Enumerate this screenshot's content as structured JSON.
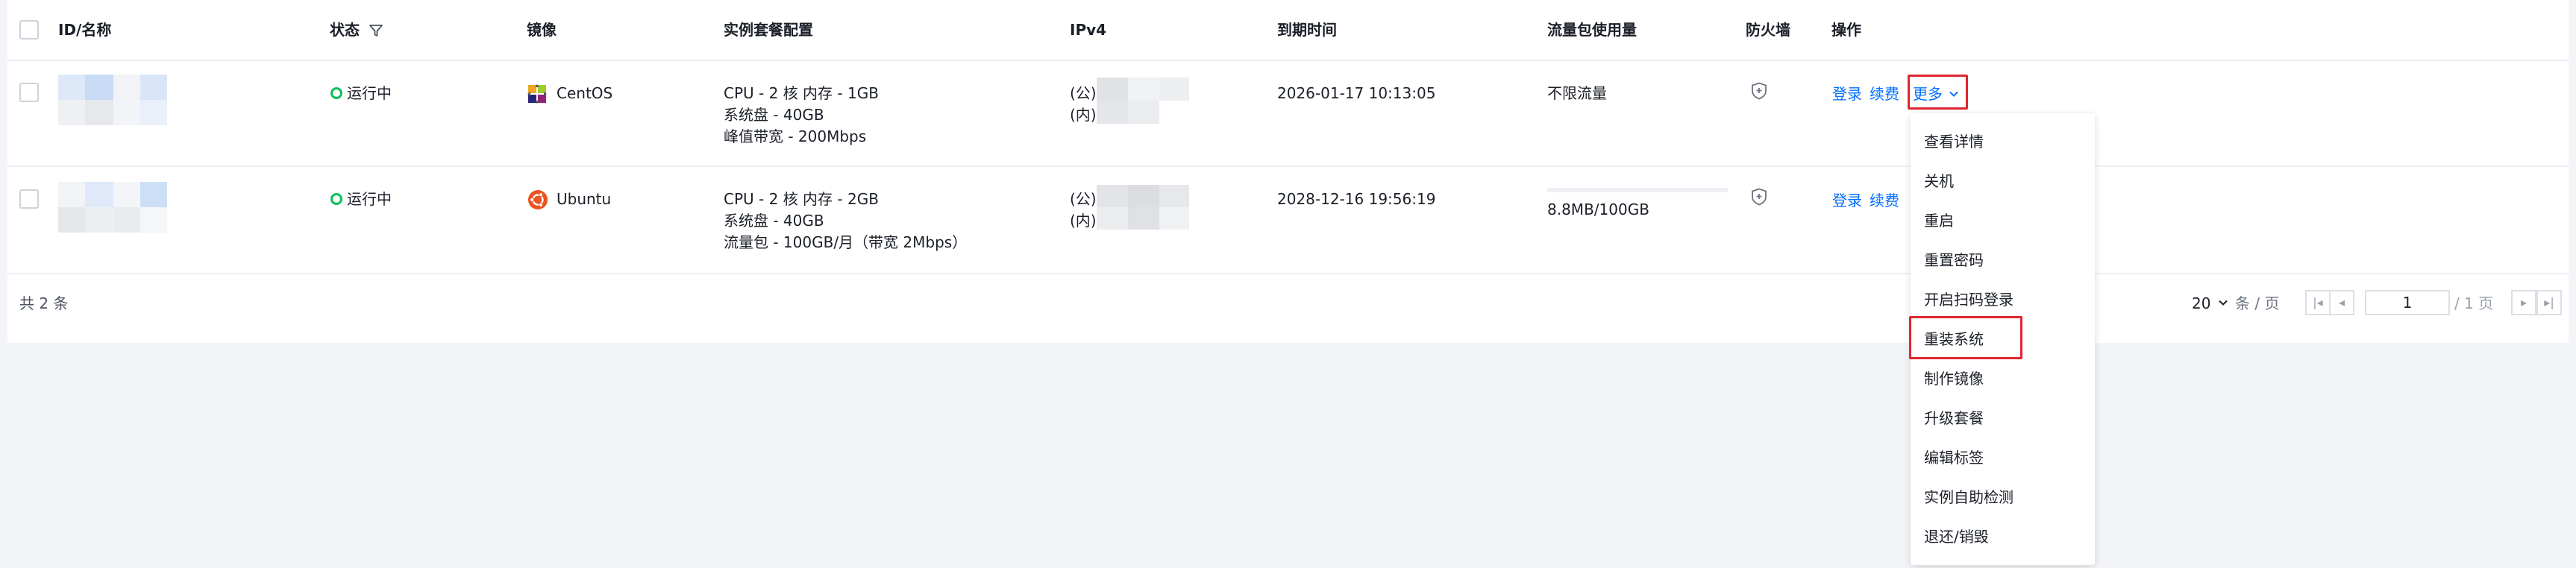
{
  "table": {
    "headers": {
      "id_name": "ID/名称",
      "status": "状态",
      "image": "镜像",
      "config": "实例套餐配置",
      "ipv4": "IPv4",
      "expire": "到期时间",
      "traffic": "流量包使用量",
      "firewall": "防火墙",
      "actions": "操作"
    },
    "rows": [
      {
        "status": "运行中",
        "image": "CentOS",
        "config": [
          "CPU - 2 核 内存 - 1GB",
          "系统盘 - 40GB",
          "峰值带宽 - 200Mbps"
        ],
        "ip_public_label": "(公)",
        "ip_private_label": "(内)",
        "expire": "2026-01-17 10:13:05",
        "traffic": "不限流量",
        "action_login": "登录",
        "action_renew": "续费",
        "action_more": "更多"
      },
      {
        "status": "运行中",
        "image": "Ubuntu",
        "config": [
          "CPU - 2 核 内存 - 2GB",
          "系统盘 - 40GB",
          "流量包 - 100GB/月（带宽 2Mbps）"
        ],
        "ip_public_label": "(公)",
        "ip_private_label": "(内)",
        "expire": "2028-12-16 19:56:19",
        "traffic": "8.8MB/100GB",
        "traffic_fraction": 0.0001,
        "action_login": "登录",
        "action_renew": "续费"
      }
    ]
  },
  "footer": {
    "total": "共 2 条",
    "page_size": "20",
    "per_page_unit": "条 / 页",
    "current_page": "1",
    "total_pages": "/ 1 页"
  },
  "more_menu": {
    "items": [
      "查看详情",
      "关机",
      "重启",
      "重置密码",
      "开启扫码登录",
      "重装系统",
      "制作镜像",
      "升级套餐",
      "编辑标签",
      "实例自助检测",
      "退还/销毁"
    ],
    "highlighted": "重装系统"
  },
  "colors": {
    "link": "#006eff",
    "running": "#0abf5b",
    "highlight_box": "#e0262f"
  },
  "icons": {
    "status_filter": "filter-icon",
    "centos": "centos-logo-icon",
    "ubuntu": "ubuntu-logo-icon",
    "firewall": "shield-icon",
    "more_chevron": "chevron-down-icon",
    "pager": [
      "first-page-icon",
      "prev-page-icon",
      "next-page-icon",
      "last-page-icon"
    ]
  }
}
